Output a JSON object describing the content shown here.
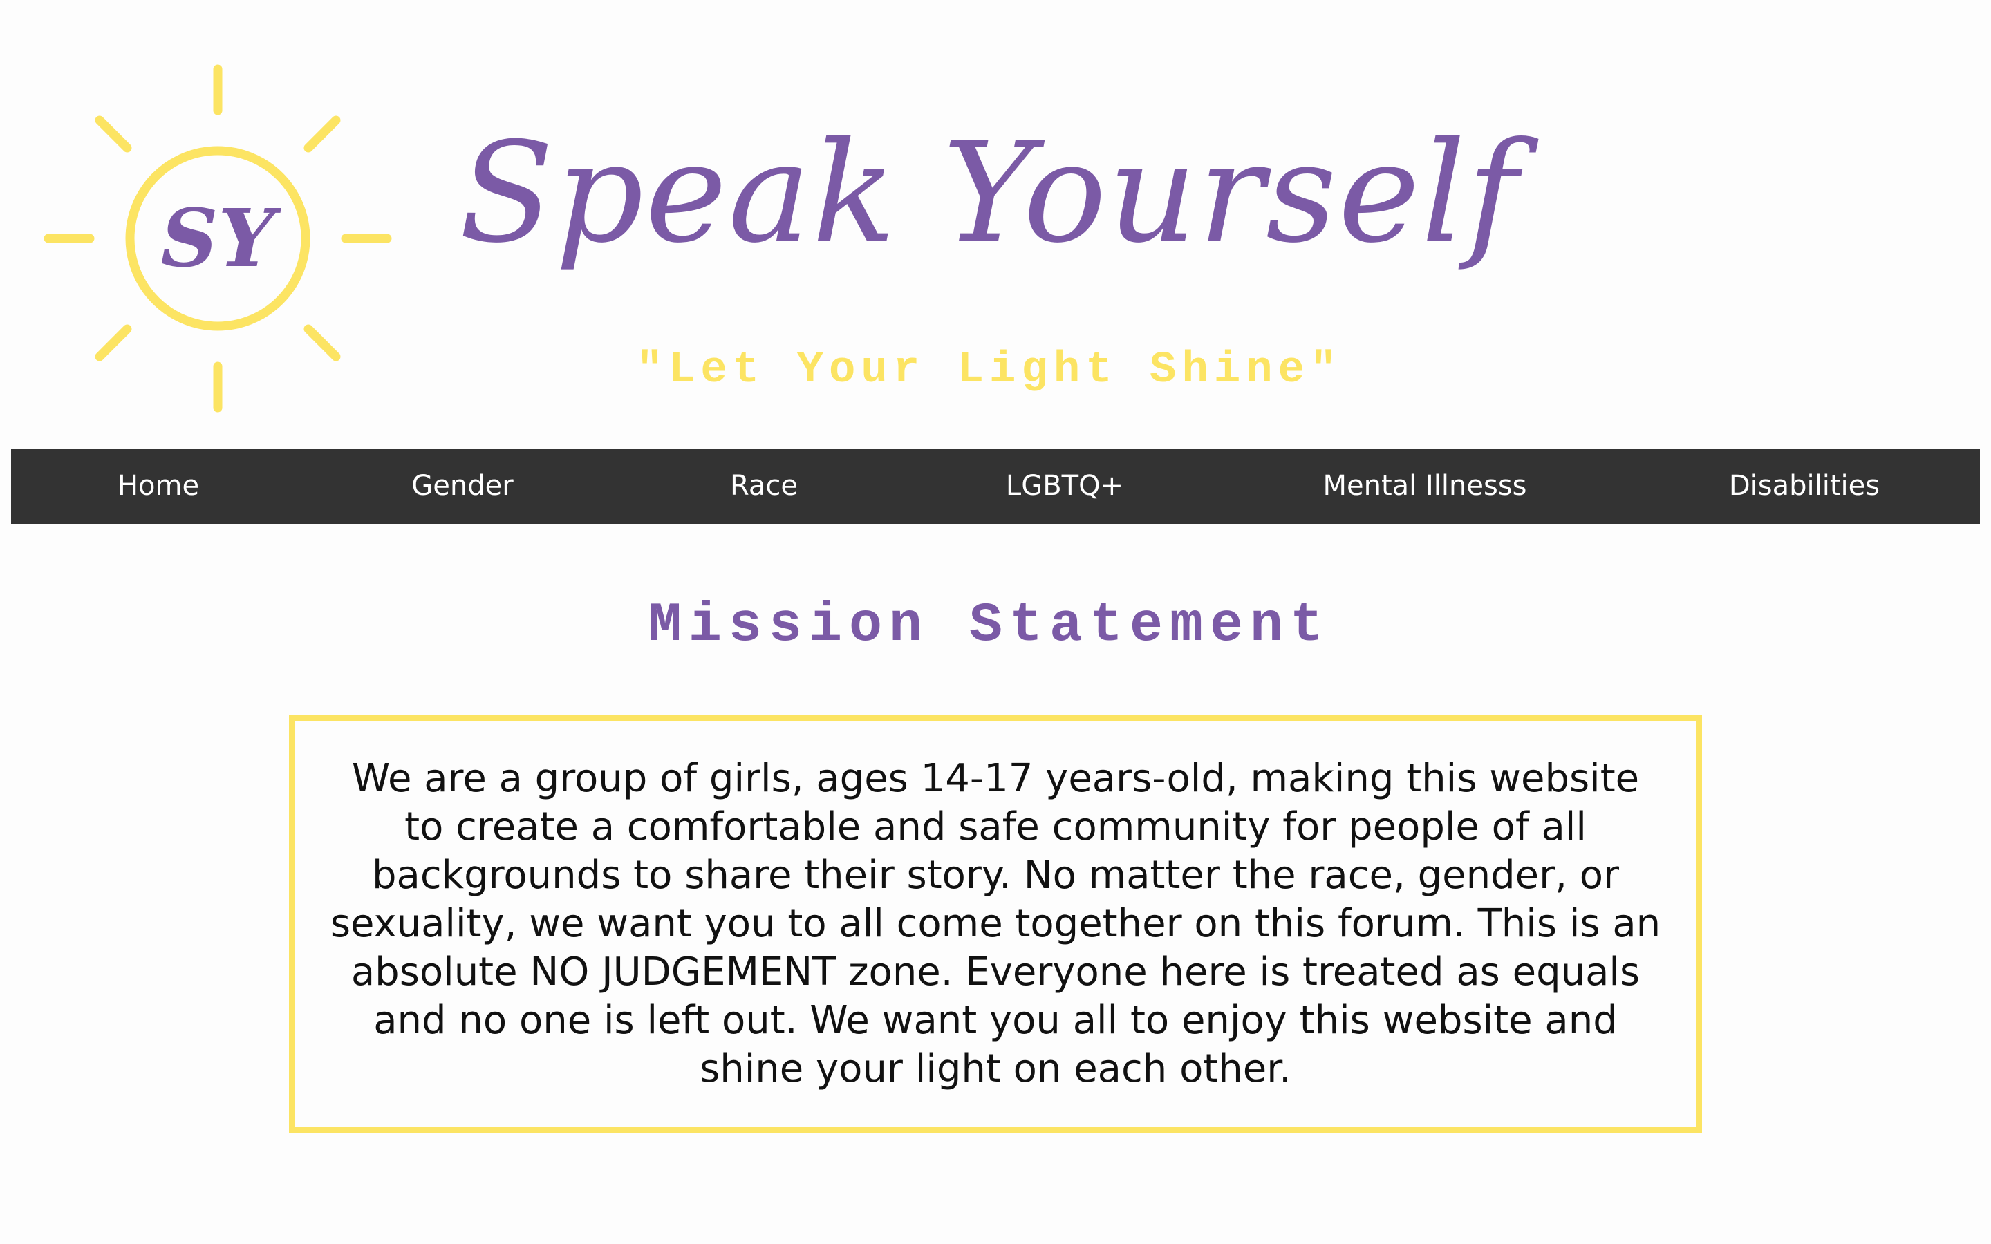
{
  "logo": {
    "initials": "SY",
    "icon": "sun-logo-icon",
    "sun_color": "#fce463",
    "initials_color": "#7b5aa6"
  },
  "header": {
    "title": "Speak Yourself",
    "tagline": "\"Let Your Light Shine\""
  },
  "nav": {
    "items": [
      {
        "label": "Home"
      },
      {
        "label": "Gender"
      },
      {
        "label": "Race"
      },
      {
        "label": "LGBTQ+"
      },
      {
        "label": "Mental Illnesss"
      },
      {
        "label": "Disabilities"
      }
    ],
    "background": "#333333",
    "text_color": "#ffffff"
  },
  "mission": {
    "title": "Mission Statement",
    "text": "We are a group of girls, ages 14-17 years-old, making this website to create a comfortable and safe community for people of all backgrounds to share their story. No matter the race, gender, or sexuality, we want you to all come together on this forum. This is an absolute NO JUDGEMENT zone. Everyone here is treated as equals and no one is left out. We want you all to enjoy this website and shine your light on each other.",
    "border_color": "#fce463"
  },
  "colors": {
    "accent_purple": "#7b5aa6",
    "accent_yellow": "#fce463",
    "background": "#fdfdfd"
  }
}
